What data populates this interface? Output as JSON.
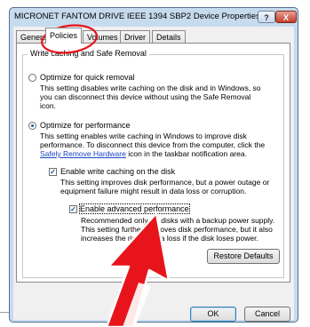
{
  "window": {
    "title": "MICRONET FANTOM DRIVE IEEE 1394 SBP2 Device Properties",
    "help_glyph": "?",
    "close_glyph": "X"
  },
  "tabs": [
    {
      "label": "General"
    },
    {
      "label": "Policies"
    },
    {
      "label": "Volumes"
    },
    {
      "label": "Driver"
    },
    {
      "label": "Details"
    }
  ],
  "group": {
    "title": "Write caching and Safe Removal",
    "quick_removal": {
      "label": "Optimize for quick removal",
      "selected": false,
      "desc": [
        "This setting disables write caching on the disk and in Windows, so",
        "you can disconnect this device without using the Safe Removal",
        "icon."
      ]
    },
    "performance": {
      "label": "Optimize for performance",
      "selected": true,
      "desc": [
        "This setting enables write caching in Windows to improve disk",
        "performance. To disconnect this device from the computer, click the"
      ],
      "link": "Safely Remove Hardware",
      "desc_tail": " icon in the taskbar notification area."
    },
    "enable_caching": {
      "label": "Enable write caching on the disk",
      "checked": true,
      "desc": [
        "This setting improves disk performance, but a power outage or",
        "equipment failure might result in data loss or corruption."
      ]
    },
    "advanced": {
      "label": "Enable advanced performance",
      "checked": true,
      "desc": [
        "Recommended only for disks with a backup power supply.",
        "This setting further improves disk performance, but it also",
        "increases the risk of data loss if the disk loses power."
      ]
    },
    "restore_label": "Restore Defaults"
  },
  "footer": {
    "ok_label": "OK",
    "cancel_label": "Cancel"
  },
  "colors": {
    "annotation": "#e8141c",
    "accent": "#1b57a8"
  }
}
